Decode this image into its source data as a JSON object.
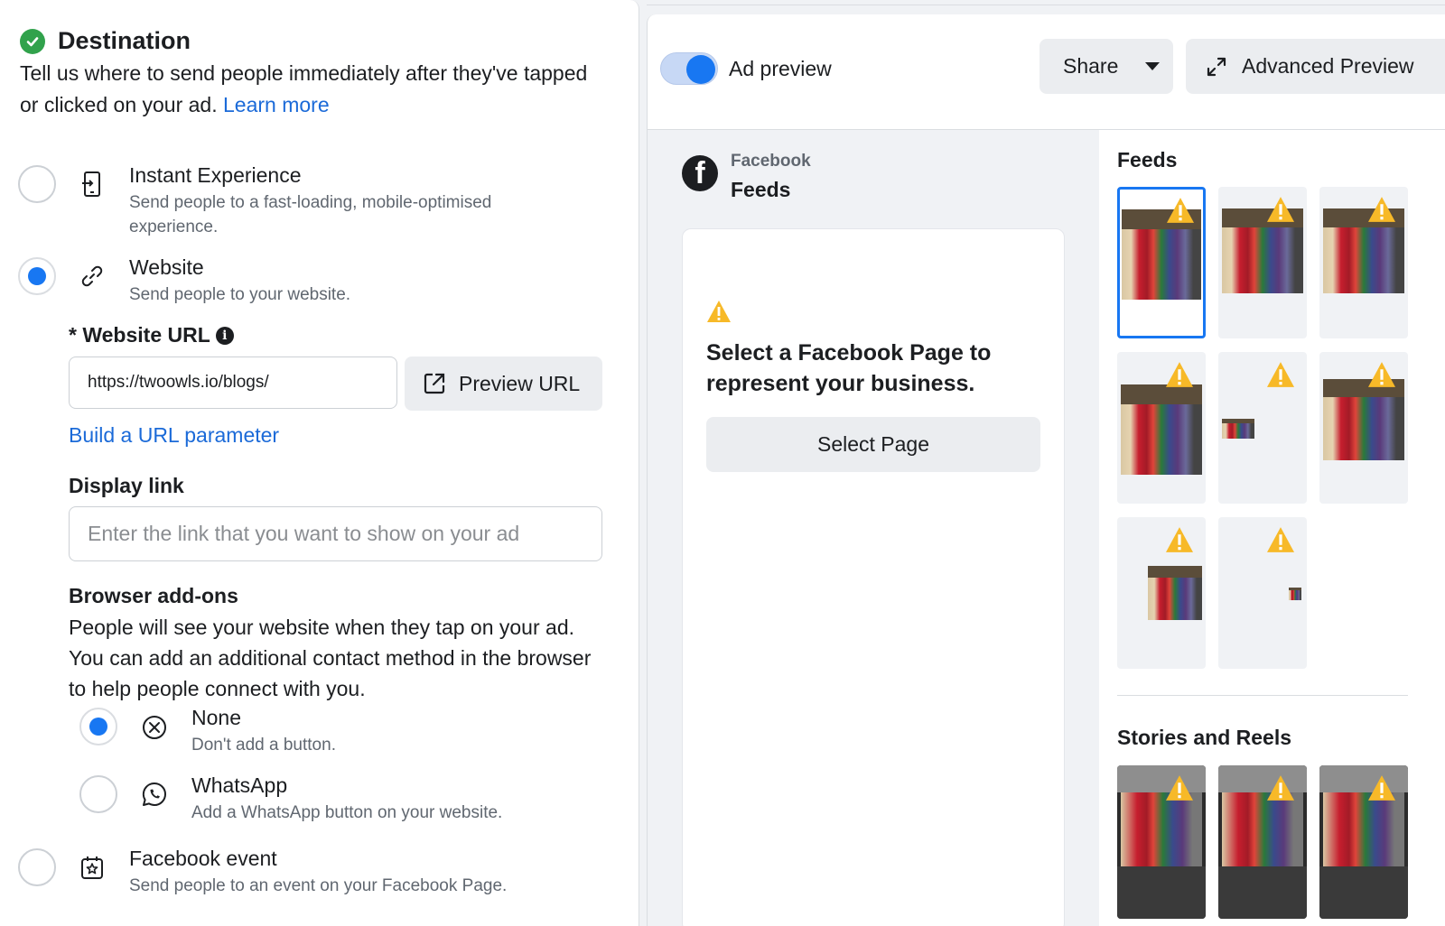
{
  "destination": {
    "title": "Destination",
    "description": "Tell us where to send people immediately after they've tapped or clicked on your ad.",
    "learn_more": "Learn more",
    "options": [
      {
        "title": "Instant Experience",
        "subtitle": "Send people to a fast-loading, mobile-optimised experience.",
        "selected": false,
        "icon": "phone-icon"
      },
      {
        "title": "Website",
        "subtitle": "Send people to your website.",
        "selected": true,
        "icon": "link-icon"
      },
      {
        "title": "Facebook event",
        "subtitle": "Send people to an event on your Facebook Page.",
        "selected": false,
        "icon": "event-star-icon"
      }
    ],
    "website_url_label": "* Website URL",
    "website_url_value": "https://twoowls.io/blogs/",
    "preview_url_label": "Preview URL",
    "build_url_param": "Build a URL parameter",
    "display_link_label": "Display link",
    "display_link_placeholder": "Enter the link that you want to show on your ad",
    "browser_addons_label": "Browser add-ons",
    "browser_addons_desc": "People will see your website when they tap on your ad. You can add an additional contact method in the browser to help people connect with you.",
    "addons": [
      {
        "title": "None",
        "subtitle": "Don't add a button.",
        "selected": true,
        "icon": "close-circle-icon"
      },
      {
        "title": "WhatsApp",
        "subtitle": "Add a WhatsApp button on your website.",
        "selected": false,
        "icon": "whatsapp-icon"
      }
    ]
  },
  "preview": {
    "toggle_label": "Ad preview",
    "toggle_on": true,
    "share_label": "Share",
    "advanced_label": "Advanced Preview",
    "platform": "Facebook",
    "placement": "Feeds",
    "card_message": "Select a Facebook Page to represent your business.",
    "select_page_label": "Select Page",
    "feeds_title": "Feeds",
    "stories_title": "Stories and Reels"
  },
  "colors": {
    "accent": "#1877f2",
    "link": "#1b6ad8",
    "success": "#31a24c",
    "warning": "#f7b928"
  }
}
